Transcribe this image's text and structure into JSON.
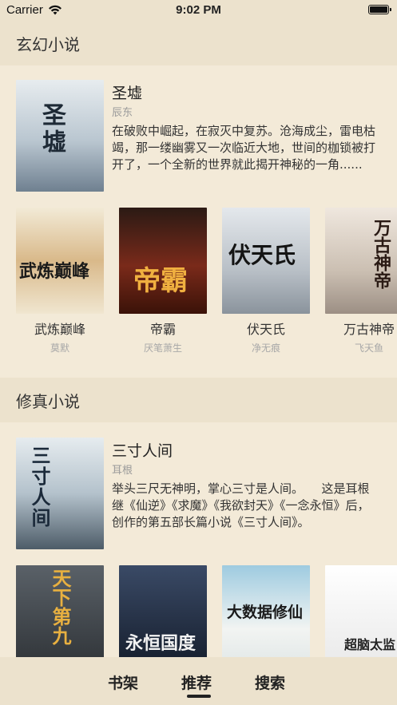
{
  "status": {
    "carrier": "Carrier",
    "time": "9:02 PM"
  },
  "sections": [
    {
      "title": "玄幻小说",
      "featured": {
        "title": "圣墟",
        "author": "辰东",
        "description": "在破败中崛起，在寂灭中复苏。沧海成尘，雷电枯竭，那一缕幽雾又一次临近大地，世间的枷锁被打开了，一个全新的世界就此揭开神秘的一角......",
        "cover_text": "圣墟",
        "cover_color": "#c8d3dc"
      },
      "books": [
        {
          "title": "武炼巅峰",
          "author": "莫默",
          "cover_text": "武炼巅峰",
          "cover_color": "#e8dcc0"
        },
        {
          "title": "帝霸",
          "author": "厌笔萧生",
          "cover_text": "帝霸",
          "cover_color": "#6b2216"
        },
        {
          "title": "伏天氏",
          "author": "净无痕",
          "cover_text": "伏天氏",
          "cover_color": "#c9ccd0"
        },
        {
          "title": "万古神帝",
          "author": "飞天鱼",
          "cover_text": "万古神帝",
          "cover_color": "#d9cfc6"
        }
      ]
    },
    {
      "title": "修真小说",
      "featured": {
        "title": "三寸人间",
        "author": "耳根",
        "description": "举头三尺无神明，掌心三寸是人间。　　这是耳根继《仙逆》《求魔》《我欲封天》《一念永恒》后，创作的第五部长篇小说《三寸人间》。",
        "cover_text": "三寸人间",
        "cover_color": "#cfd7dc"
      },
      "books": [
        {
          "title": "",
          "author": "",
          "cover_text": "天下第九",
          "cover_color": "#3a3f44"
        },
        {
          "title": "",
          "author": "",
          "cover_text": "永恒国度",
          "cover_color": "#1e2a3c"
        },
        {
          "title": "",
          "author": "",
          "cover_text": "大数据修仙",
          "cover_color": "#dfe6e6"
        },
        {
          "title": "",
          "author": "",
          "cover_text": "超脑太监",
          "cover_color": "#f0f0f0"
        }
      ]
    }
  ],
  "tabs": [
    "书架",
    "推荐",
    "搜索"
  ],
  "active_tab": "推荐"
}
